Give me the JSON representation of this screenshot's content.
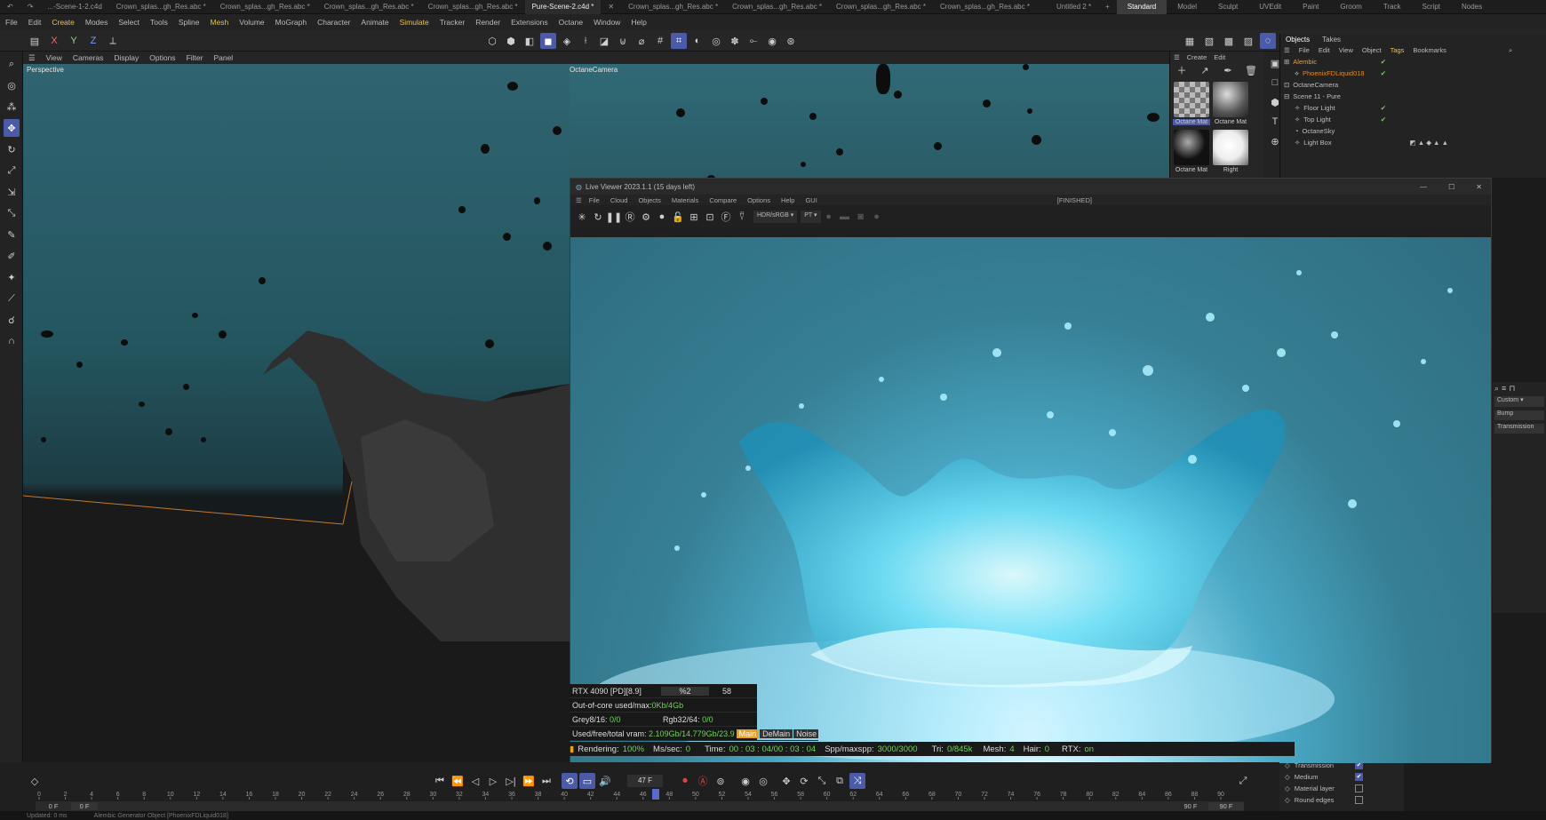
{
  "file_tabs": [
    "...-Scene-1-2.c4d",
    "Crown_splas...gh_Res.abc *",
    "Crown_splas...gh_Res.abc *",
    "Crown_splas...gh_Res.abc *",
    "Crown_splas...gh_Res.abc *",
    "Pure-Scene-2.c4d *",
    "Crown_splas...gh_Res.abc *",
    "Crown_splas...gh_Res.abc *",
    "Crown_splas...gh_Res.abc *",
    "Crown_splas...gh_Res.abc *",
    "Untitled 2 *"
  ],
  "active_tab": "Pure-Scene-2.c4d *",
  "layouts": [
    "Standard",
    "Model",
    "Sculpt",
    "UVEdit",
    "Paint",
    "Groom",
    "Track",
    "Script",
    "Nodes"
  ],
  "menu": [
    "File",
    "Edit",
    "Create",
    "Modes",
    "Select",
    "Tools",
    "Spline",
    "Mesh",
    "Volume",
    "MoGraph",
    "Character",
    "Animate",
    "Simulate",
    "Tracker",
    "Render",
    "Extensions",
    "Octane",
    "Window",
    "Help"
  ],
  "axes": {
    "x": "X",
    "y": "Y",
    "z": "Z"
  },
  "viewport": {
    "menu": [
      "View",
      "Cameras",
      "Display",
      "Options",
      "Filter",
      "Panel"
    ],
    "label": "Perspective",
    "camera": "OctaneCamera"
  },
  "materials": {
    "toolbar": [
      "Create",
      "Edit"
    ],
    "items": [
      "Octane Mat",
      "Octane Mat",
      "Octane Mat",
      "Right"
    ]
  },
  "objects": {
    "tabs": [
      "Objects",
      "Takes"
    ],
    "menu": [
      "File",
      "Edit",
      "View",
      "Object",
      "Tags",
      "Bookmarks"
    ],
    "rows": [
      {
        "name": "Alembic",
        "color": "#e5a03a"
      },
      {
        "name": "PhoenixFDLiquid018",
        "color": "#e08a2a"
      },
      {
        "name": "OctaneCamera",
        "color": "#cfcfcf"
      },
      {
        "name": "Scene 11 - Pure",
        "color": "#cfcfcf"
      },
      {
        "name": "Floor Light",
        "color": "#cfcfcf"
      },
      {
        "name": "Top Light",
        "color": "#cfcfcf"
      },
      {
        "name": "OctaneSky",
        "color": "#cfcfcf"
      },
      {
        "name": "Light Box",
        "color": "#cfcfcf"
      }
    ]
  },
  "attributes": {
    "dropdown": "Custom",
    "items": [
      "Bump",
      "Transmission"
    ]
  },
  "attr_list": [
    "Transmission",
    "Medium",
    "Material layer",
    "Round edges"
  ],
  "live_viewer": {
    "title": "Live Viewer 2023.1.1 (15 days left)",
    "state": "[FINISHED]",
    "menu": [
      "File",
      "Cloud",
      "Objects",
      "Materials",
      "Compare",
      "Options",
      "Help",
      "GUI"
    ],
    "colorspace": "HDR/sRGB",
    "kernel": "PT"
  },
  "stats": {
    "gpu": "RTX 4090 [PD][8.9]",
    "pct": "%2",
    "num": "58",
    "ooc_label": "Out-of-core used/max:",
    "ooc_val": "0Kb/4Gb",
    "grey_label": "Grey8/16:",
    "grey_val": "0/0",
    "rgb_label": "Rgb32/64:",
    "rgb_val": "0/0",
    "vram_label": "Used/free/total vram:",
    "vram_val": "2.109Gb/14.779Gb/23.9",
    "tabs": [
      "Main",
      "DeMain",
      "Noise"
    ]
  },
  "render_status": {
    "rendering_label": "Rendering:",
    "rendering": "100%",
    "ms_label": "Ms/sec:",
    "ms": "0",
    "time_label": "Time:",
    "time": "00 : 03 : 04/00 : 03 : 04",
    "spp_label": "Spp/maxspp:",
    "spp": "3000/3000",
    "tri_label": "Tri:",
    "tri": "0/845k",
    "mesh_label": "Mesh:",
    "mesh": "4",
    "hair_label": "Hair:",
    "hair": "0",
    "rtx_label": "RTX:",
    "rtx": "on"
  },
  "timeline": {
    "frame": "47 F",
    "start": "0 F",
    "start2": "0 F",
    "end": "90 F",
    "end2": "90 F",
    "ticks": [
      "0",
      "2",
      "4",
      "6",
      "8",
      "10",
      "12",
      "14",
      "16",
      "18",
      "20",
      "22",
      "24",
      "26",
      "28",
      "30",
      "32",
      "34",
      "36",
      "38",
      "40",
      "42",
      "44",
      "46",
      "48",
      "50",
      "52",
      "54",
      "56",
      "58",
      "60",
      "62",
      "64",
      "66",
      "68",
      "70",
      "72",
      "74",
      "76",
      "78",
      "80",
      "82",
      "84",
      "86",
      "88",
      "90"
    ],
    "playhead_fraction": 0.522
  },
  "statusbar": [
    "Updated: 0 ms",
    "Alembic Generator Object [PhoenixFDLiquid018]"
  ],
  "colors": {
    "accent": "#4b5ba8",
    "green": "#6ed35a",
    "orange": "#e08a2a",
    "yellow": "#e7c24a"
  }
}
